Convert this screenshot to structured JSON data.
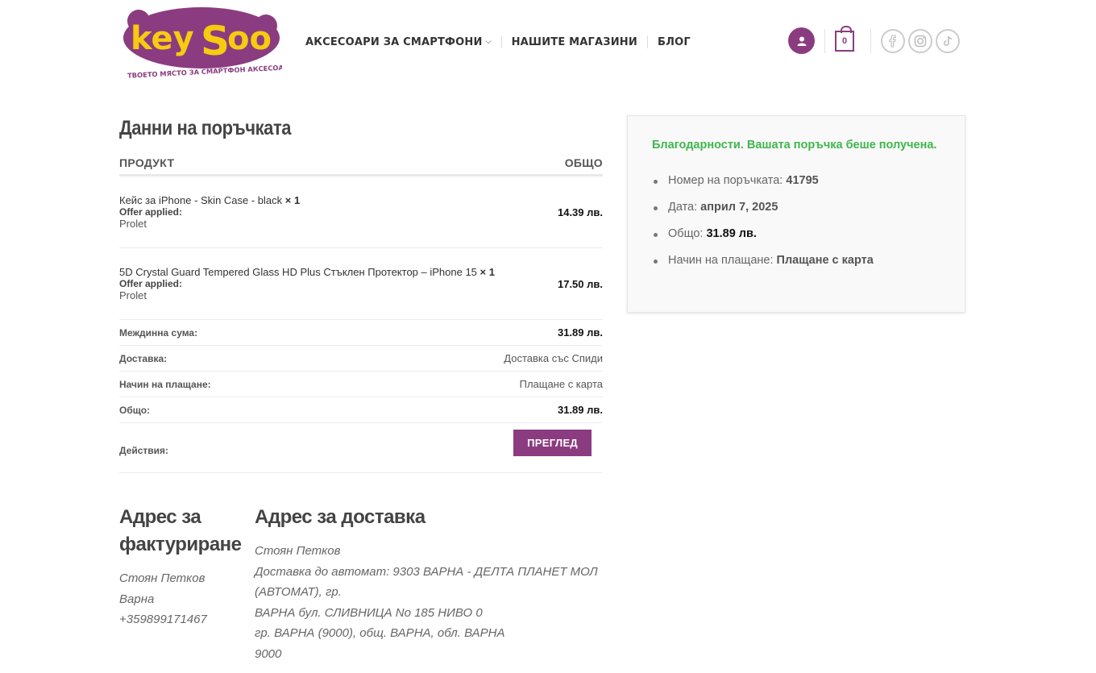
{
  "brand": {
    "logo_text_key": "key",
    "logo_text_soo": "Soo",
    "tagline": "ТВОЕТО МЯСТО ЗА СМАРТФОН АКСЕСОАРИ!",
    "purple": "#8b3c80",
    "yellow": "#f7cb10"
  },
  "nav": {
    "items": [
      {
        "label": "АКСЕСОАРИ ЗА СМАРТФОНИ"
      },
      {
        "label": "НАШИТЕ МАГАЗИНИ"
      },
      {
        "label": "БЛОГ"
      }
    ]
  },
  "header": {
    "cart_count": "0",
    "account_icon": "user-icon",
    "social": [
      "facebook-icon",
      "instagram-icon",
      "tiktok-icon"
    ]
  },
  "order": {
    "heading": "Данни на поръчката",
    "col_product": "ПРОДУКТ",
    "col_total": "ОБЩО",
    "items": [
      {
        "name": "Кейс за iPhone - Skin Case - black",
        "qty": "× 1",
        "offer_label": "Offer applied:",
        "offer_value": "Prolet",
        "total": "14.39 лв."
      },
      {
        "name": "5D Crystal Guard Tempered Glass HD Plus Стъклен Протектор – iPhone 15",
        "qty": "× 1",
        "offer_label": "Offer applied:",
        "offer_value": "Prolet",
        "total": "17.50 лв."
      }
    ],
    "summary": [
      {
        "label": "Междинна сума:",
        "value": "31.89 лв."
      },
      {
        "label": "Доставка:",
        "value": "Доставка със Спиди"
      },
      {
        "label": "Начин на плащане:",
        "value": "Плащане с карта"
      },
      {
        "label": "Общо:",
        "value": "31.89 лв."
      }
    ],
    "actions_label": "Действия:",
    "view_button": "ПРЕГЛЕД"
  },
  "billing": {
    "heading_line1": "Адрес за",
    "heading_line2": "фактуриране",
    "name": "Стоян Петков",
    "city": "Варна",
    "phone": "+359899171467"
  },
  "shipping": {
    "heading": "Адрес за доставка",
    "name": "Стоян Петков",
    "line1": "Доставка до автомат: 9303 ВАРНА - ДЕЛТА ПЛАНЕТ МОЛ (АВТОМАТ), гр.",
    "line2": "ВАРНА бул. СЛИВНИЦА No 185 НИВО 0",
    "line3": "гр. ВАРНА (9000), общ. ВАРНА, обл. ВАРНА",
    "line4": "9000"
  },
  "confirmation": {
    "thanks": "Благодарности. Вашата поръчка беше получена.",
    "order_no_label": "Номер на поръчката:",
    "order_no": "41795",
    "date_label": "Дата:",
    "date": "април 7, 2025",
    "total_label": "Общо:",
    "total": "31.89 лв.",
    "payment_label": "Начин на плащане:",
    "payment": "Плащане с карта",
    "accent": "#3fb64c"
  }
}
